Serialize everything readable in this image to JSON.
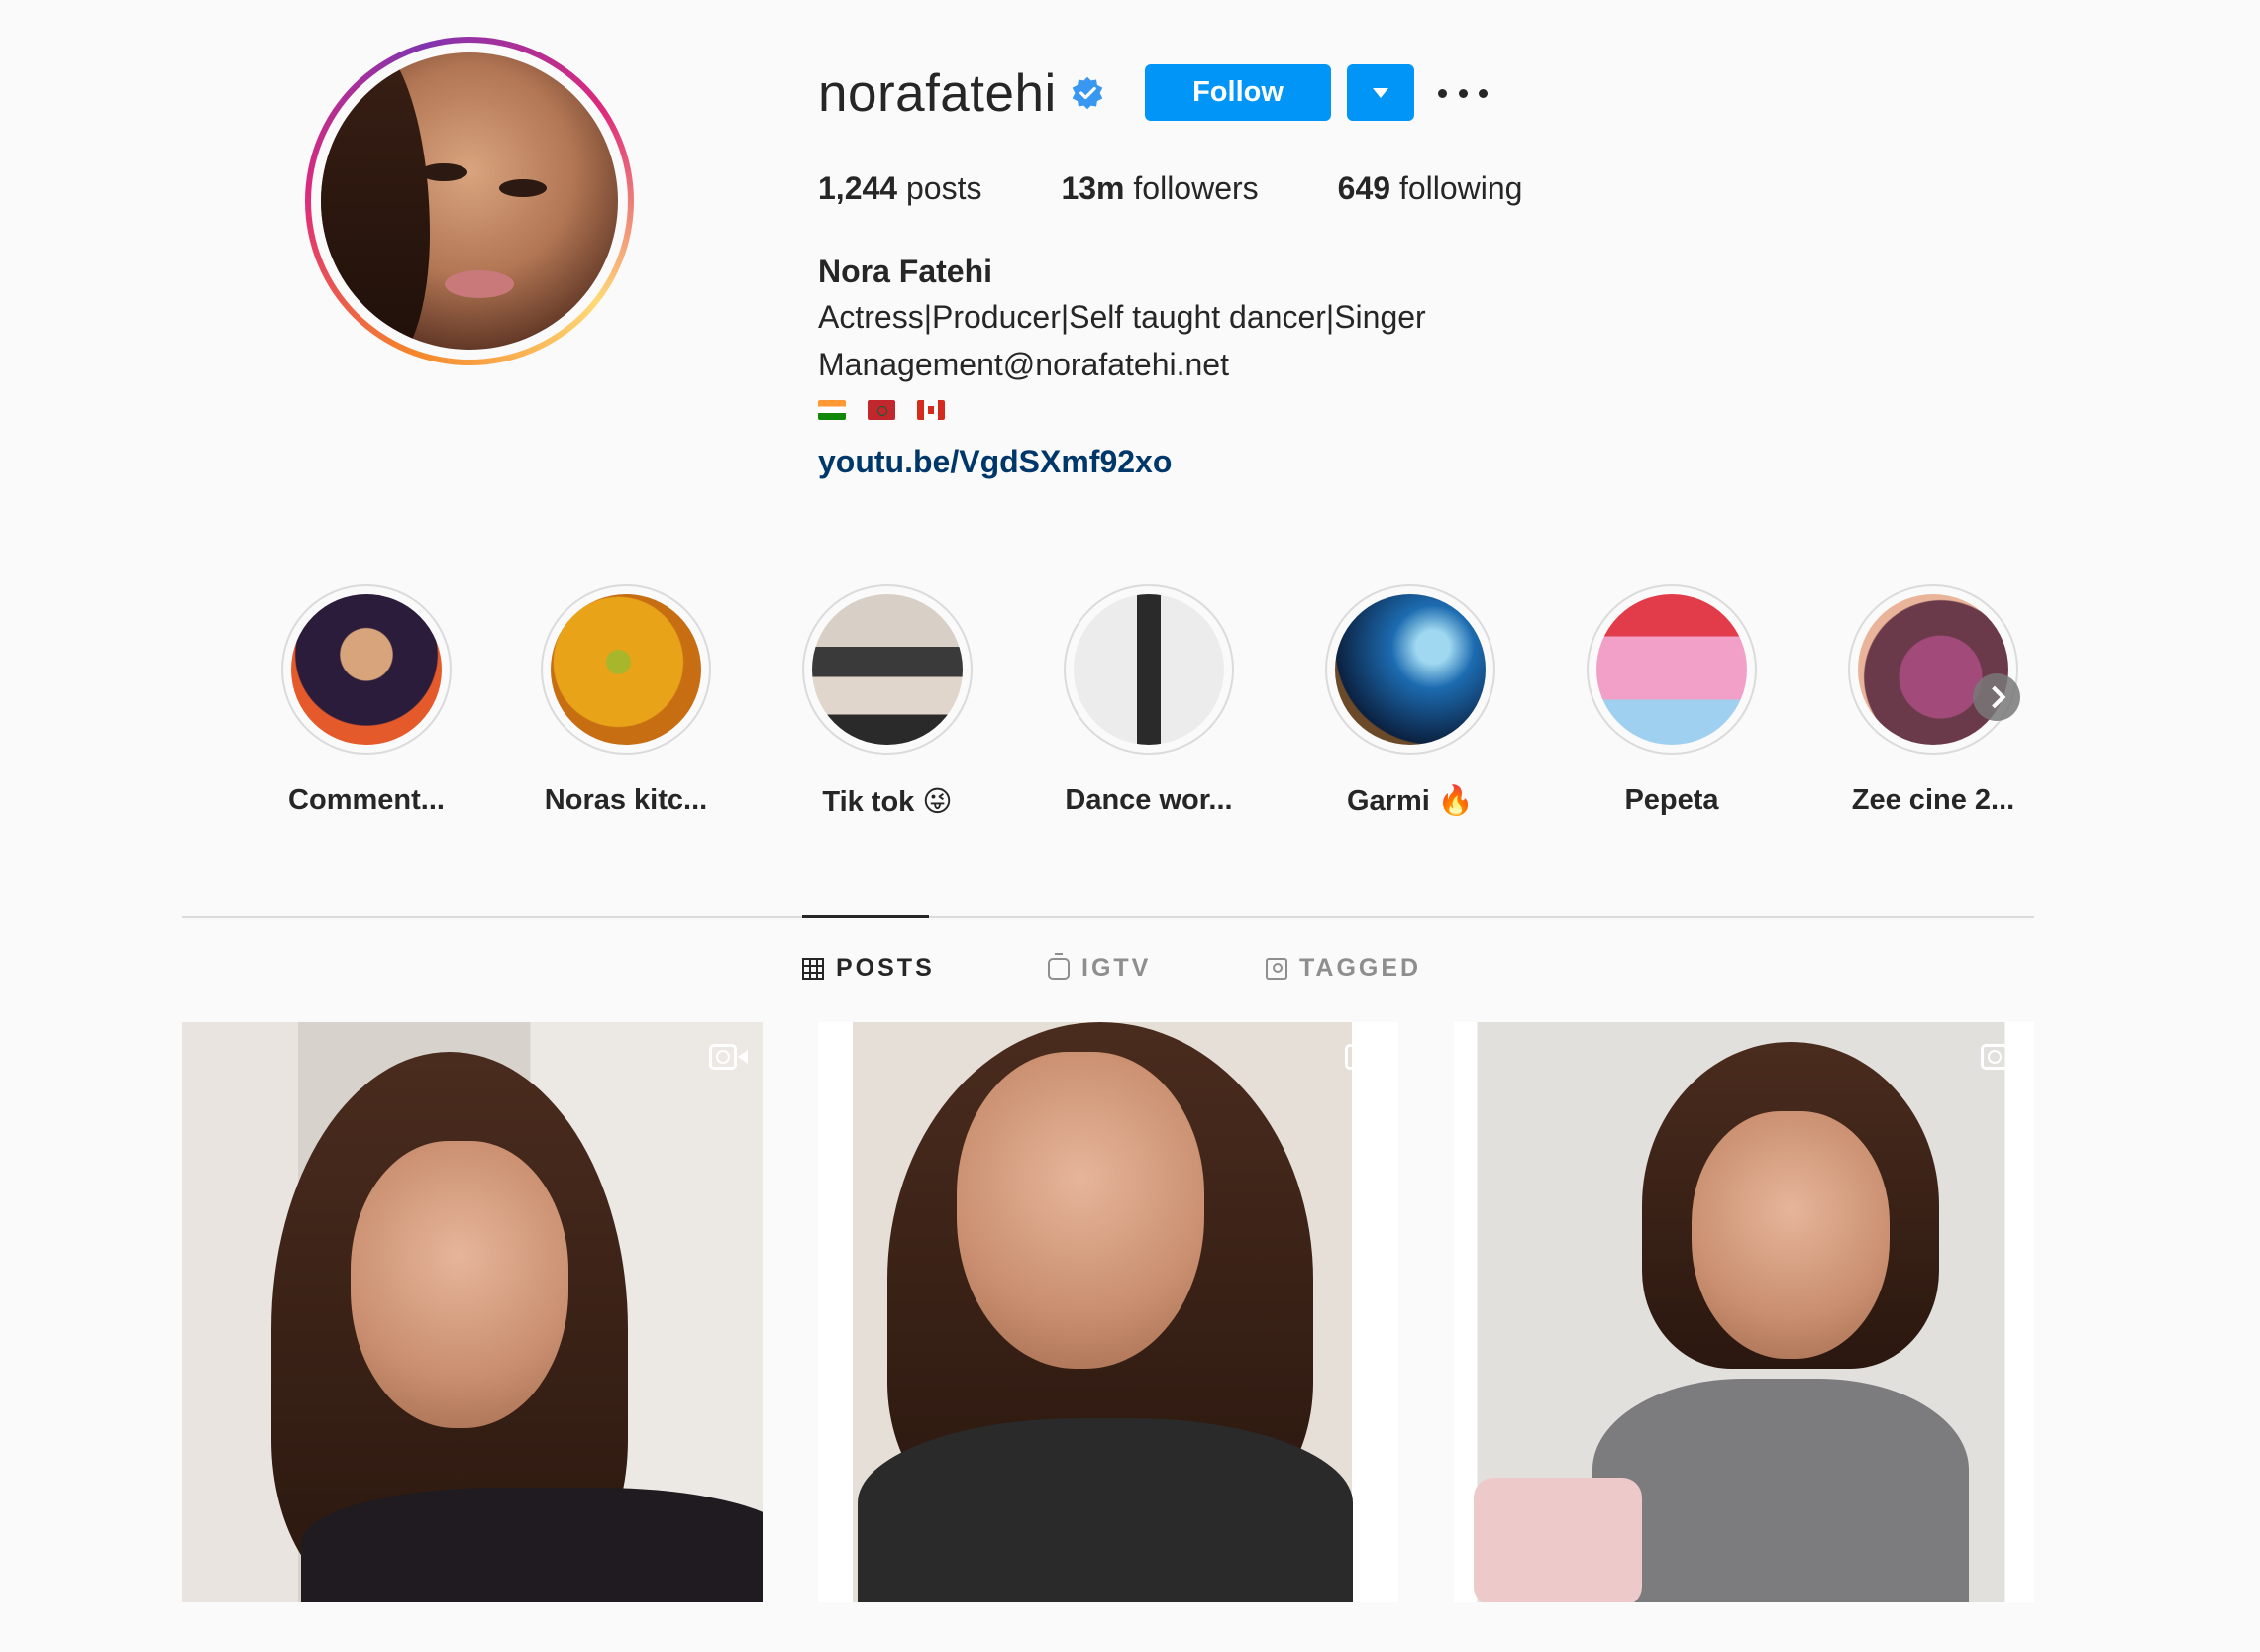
{
  "profile": {
    "username": "norafatehi",
    "follow_label": "Follow",
    "stats": {
      "posts_count": "1,244",
      "posts_label": "posts",
      "followers_count": "13m",
      "followers_label": "followers",
      "following_count": "649",
      "following_label": "following"
    },
    "full_name": "Nora Fatehi",
    "bio_lines": [
      "Actress|Producer|Self taught dancer|Singer",
      "Management@norafatehi.net"
    ],
    "flags": [
      "india-flag-icon",
      "morocco-flag-icon",
      "canada-flag-icon"
    ],
    "website": "youtu.be/VgdSXmf92xo"
  },
  "highlights": [
    {
      "label": "Comment...",
      "colors": [
        "#e45a2a",
        "#2a1c3a"
      ]
    },
    {
      "label": "Noras kitc...",
      "colors": [
        "#e8a319",
        "#c76d12"
      ]
    },
    {
      "label": "Tik tok 😜",
      "colors": [
        "#d8cfc6",
        "#3a3a3a"
      ]
    },
    {
      "label": "Dance wor...",
      "colors": [
        "#e9e9e9",
        "#8a8a8a"
      ]
    },
    {
      "label": "Garmi 🔥",
      "colors": [
        "#1c6bb0",
        "#0b2140"
      ]
    },
    {
      "label": "Pepeta",
      "colors": [
        "#f2a0c8",
        "#e23b4a"
      ]
    },
    {
      "label": "Zee cine 2...",
      "colors": [
        "#6b3a4a",
        "#a24a7a"
      ]
    }
  ],
  "tabs": [
    {
      "label": "POSTS",
      "icon": "grid-icon",
      "active": true
    },
    {
      "label": "IGTV",
      "icon": "igtv-icon",
      "active": false
    },
    {
      "label": "TAGGED",
      "icon": "tagged-icon",
      "active": false
    }
  ],
  "posts": [
    {
      "type": "video",
      "icon": "video-icon"
    },
    {
      "type": "video",
      "icon": "video-icon"
    },
    {
      "type": "video",
      "icon": "video-icon"
    }
  ],
  "colors": {
    "accent": "#0095f6",
    "link": "#00376b",
    "text": "#262626",
    "muted": "#8e8e8e",
    "background": "#fafafa"
  }
}
